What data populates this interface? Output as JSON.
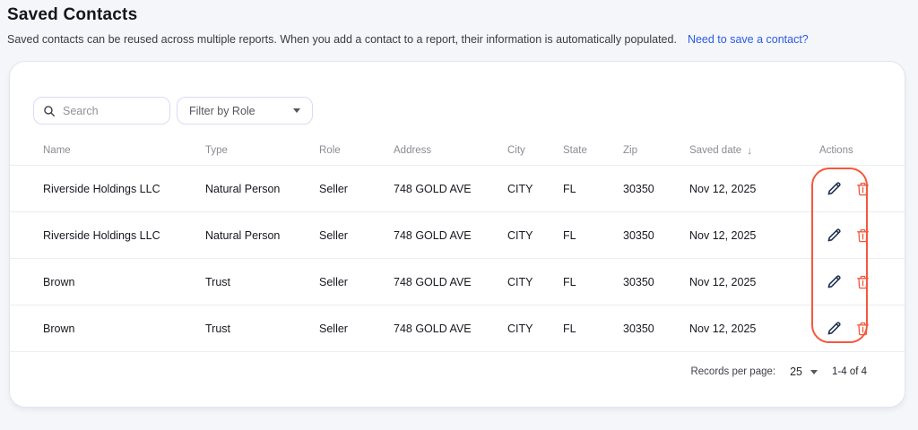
{
  "page": {
    "title": "Saved Contacts",
    "subtitle": "Saved contacts can be reused across multiple reports. When you add a contact to a report, their information is automatically populated.",
    "link_label": "Need to save a contact?"
  },
  "toolbar": {
    "search_placeholder": "Search",
    "filter_label": "Filter by Role"
  },
  "table": {
    "columns": [
      "Name",
      "Type",
      "Role",
      "Address",
      "City",
      "State",
      "Zip",
      "Saved date",
      "Actions"
    ],
    "sort_column": "Saved date",
    "sort_direction": "desc",
    "sort_icon": "↓",
    "rows": [
      {
        "name": "Riverside Holdings LLC",
        "type": "Natural Person",
        "role": "Seller",
        "address": "748 GOLD AVE",
        "city": "CITY",
        "state": "FL",
        "zip": "30350",
        "saved_date": "Nov 12, 2025"
      },
      {
        "name": "Riverside Holdings LLC",
        "type": "Natural Person",
        "role": "Seller",
        "address": "748 GOLD AVE",
        "city": "CITY",
        "state": "FL",
        "zip": "30350",
        "saved_date": "Nov 12, 2025"
      },
      {
        "name": "Brown",
        "type": "Trust",
        "role": "Seller",
        "address": "748 GOLD AVE",
        "city": "CITY",
        "state": "FL",
        "zip": "30350",
        "saved_date": "Nov 12, 2025"
      },
      {
        "name": "Brown",
        "type": "Trust",
        "role": "Seller",
        "address": "748 GOLD AVE",
        "city": "CITY",
        "state": "FL",
        "zip": "30350",
        "saved_date": "Nov 12, 2025"
      }
    ]
  },
  "pagination": {
    "records_per_page_label": "Records per page:",
    "records_per_page_value": "25",
    "range_label": "1-4 of 4"
  },
  "colors": {
    "link_blue": "#2b5be3",
    "annotation_orange": "#f4583c",
    "delete_icon_orange": "#f4583c",
    "edit_icon_navy": "#223253",
    "input_border_lavender": "#d9dbf5",
    "page_background": "#f5f6fa"
  }
}
